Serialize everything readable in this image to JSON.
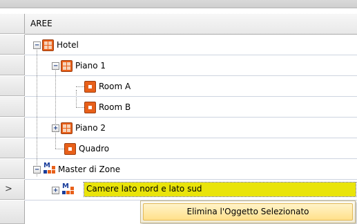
{
  "grid": {
    "column_header": "AREE",
    "current_row_indicator": ">"
  },
  "tree": {
    "nodes": [
      {
        "label": "Hotel",
        "icon": "grid-area-icon",
        "expander": "−"
      },
      {
        "label": "Piano 1",
        "icon": "grid-area-icon",
        "expander": "−"
      },
      {
        "label": "Room A",
        "icon": "room-icon",
        "expander": ""
      },
      {
        "label": "Room B",
        "icon": "room-icon",
        "expander": ""
      },
      {
        "label": "Piano 2",
        "icon": "grid-area-icon",
        "expander": "+"
      },
      {
        "label": "Quadro",
        "icon": "room-icon",
        "expander": ""
      },
      {
        "label": "Master di Zone",
        "icon": "master-zone-icon",
        "expander": "−"
      },
      {
        "label": "Camere lato nord e lato sud",
        "icon": "master-zone-icon",
        "expander": "+",
        "selected": true
      }
    ]
  },
  "context_menu": {
    "items": [
      {
        "label": "Elimina l'Oggetto Selezionato"
      }
    ]
  },
  "colors": {
    "selection": "#e9e40a",
    "icon_orange": "#e8601a",
    "icon_blue": "#1a3d9a",
    "menu_highlight": "#ffe08a"
  }
}
